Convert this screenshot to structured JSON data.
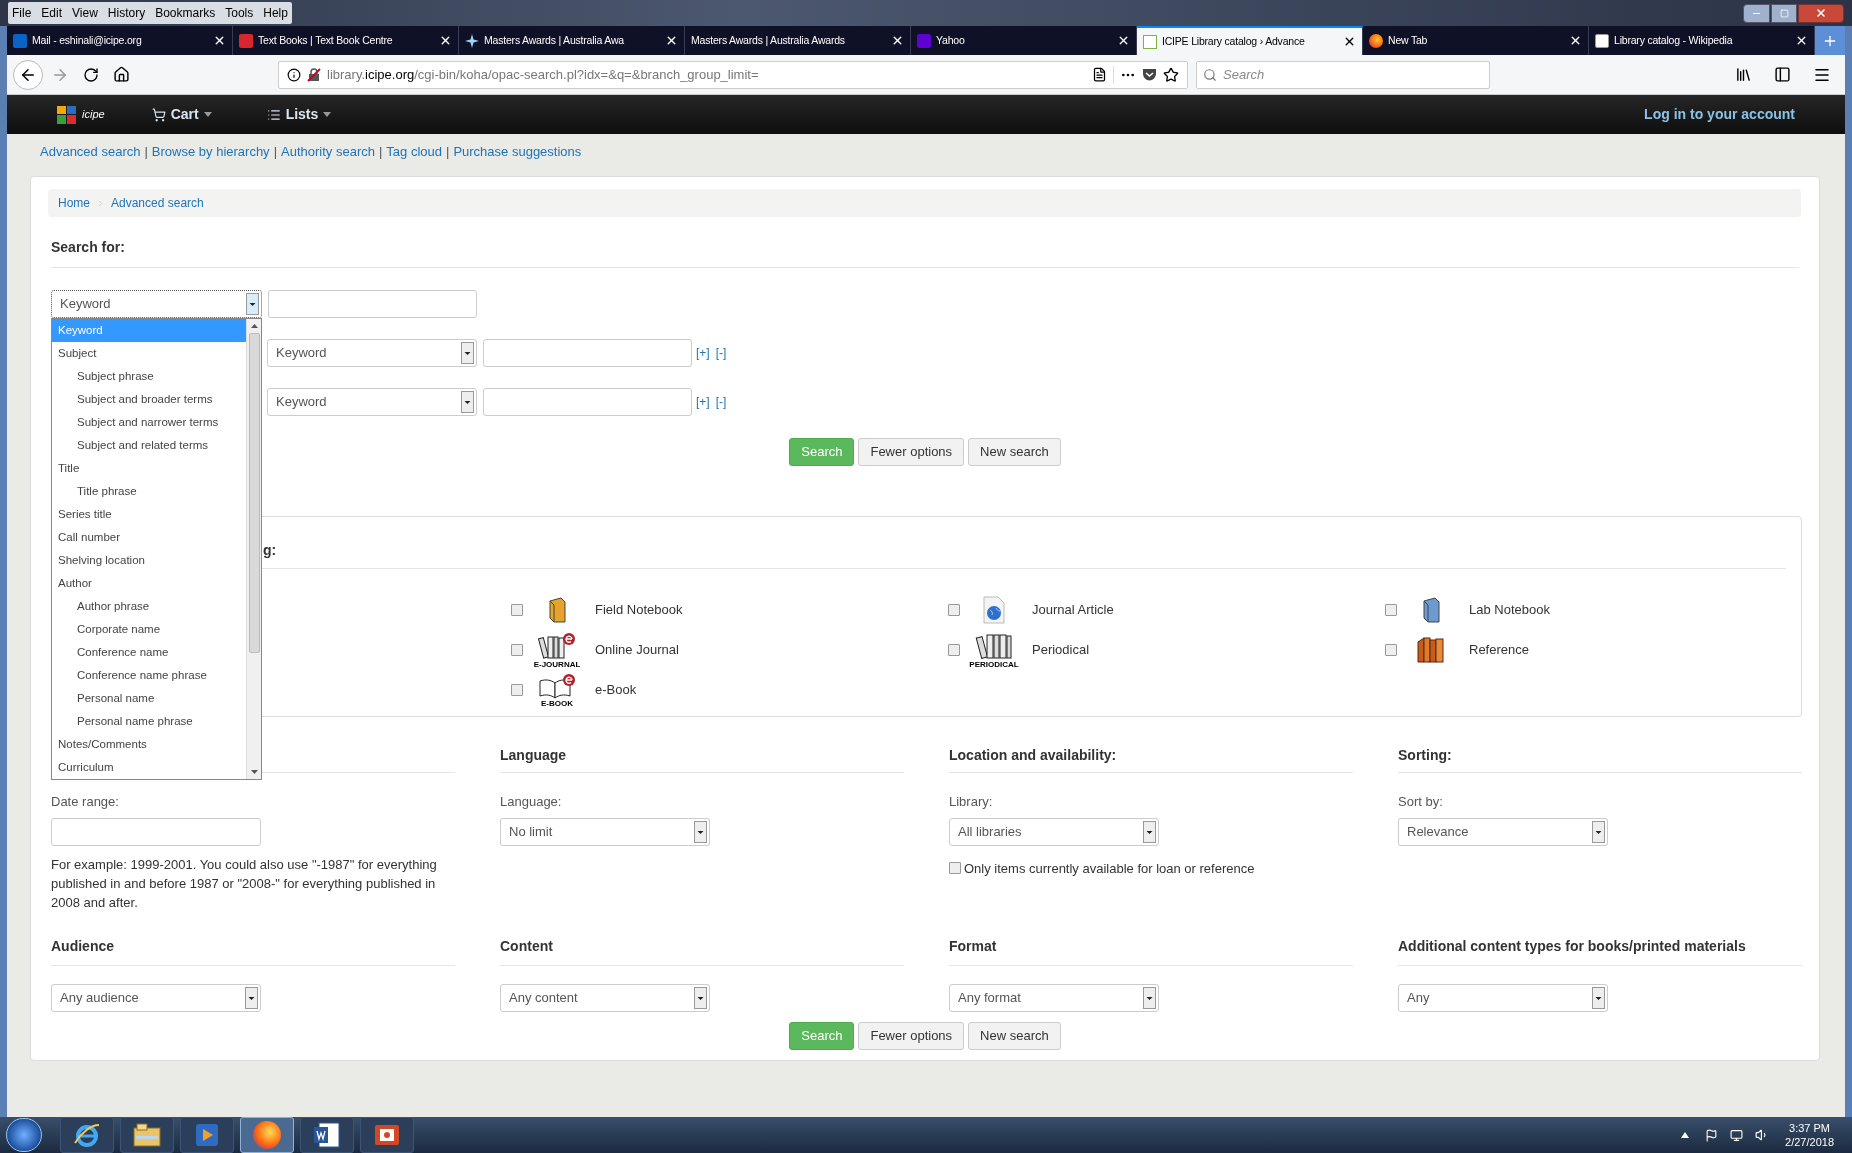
{
  "browser": {
    "menu": [
      "File",
      "Edit",
      "View",
      "History",
      "Bookmarks",
      "Tools",
      "Help"
    ],
    "tabs": [
      {
        "title": "Mail - eshinali@icipe.org",
        "kind": "mail",
        "selected": false
      },
      {
        "title": "Text Books | Text Book Centre",
        "kind": "textbook",
        "selected": false
      },
      {
        "title": "Masters Awards | Australia Awa",
        "kind": "star",
        "selected": false
      },
      {
        "title": "Masters Awards | Australia Awards",
        "kind": "none",
        "selected": false
      },
      {
        "title": "Yahoo",
        "kind": "yahoo",
        "selected": false
      },
      {
        "title": "ICIPE Library catalog › Advance",
        "kind": "koha",
        "selected": true
      },
      {
        "title": "New Tab",
        "kind": "firefox",
        "selected": false
      },
      {
        "title": "Library catalog - Wikipedia",
        "kind": "wikipedia",
        "selected": false
      }
    ],
    "url": "library.**icipe.org**/cgi-bin/koha/opac-search.pl?idx=&q=&branch_group_limit=",
    "search_placeholder": "Search"
  },
  "site": {
    "logo": "icipe",
    "nav": [
      {
        "label": "Cart",
        "kind": "cart"
      },
      {
        "label": "Lists",
        "kind": "list"
      }
    ],
    "login": "Log in to your account",
    "links": [
      "Advanced search",
      "Browse by hierarchy",
      "Authority search",
      "Tag cloud",
      "Purchase suggestions"
    ],
    "link_separator": "|"
  },
  "breadcrumbs": [
    "Home",
    "Advanced search"
  ],
  "search": {
    "heading": "Search for:",
    "rows": [
      {
        "index": "Keyword",
        "open": true
      },
      {
        "index": "Keyword",
        "open": false,
        "add": "[+]",
        "remove": "[-]"
      },
      {
        "index": "Keyword",
        "open": false,
        "add": "[+]",
        "remove": "[-]"
      }
    ],
    "index_options": [
      {
        "label": "Keyword",
        "selected": true
      },
      {
        "label": "Subject",
        "selected": false,
        "children": [
          {
            "label": "Subject phrase",
            "selected": false
          },
          {
            "label": "Subject and broader terms",
            "selected": false
          },
          {
            "label": "Subject and narrower terms",
            "selected": false
          },
          {
            "label": "Subject and related terms",
            "selected": false
          }
        ]
      },
      {
        "label": "Title",
        "selected": false,
        "children": [
          {
            "label": "Title phrase",
            "selected": false
          }
        ]
      },
      {
        "label": "Series title",
        "selected": false
      },
      {
        "label": "Call number",
        "selected": false
      },
      {
        "label": "Shelving location",
        "selected": false
      },
      {
        "label": "Author",
        "selected": false,
        "children": [
          {
            "label": "Author phrase",
            "selected": false
          },
          {
            "label": "Corporate name",
            "selected": false
          },
          {
            "label": "Conference name",
            "selected": false
          },
          {
            "label": "Conference name phrase",
            "selected": false
          },
          {
            "label": "Personal name",
            "selected": false
          },
          {
            "label": "Personal name phrase",
            "selected": false
          }
        ]
      },
      {
        "label": "Notes/Comments",
        "selected": false
      },
      {
        "label": "Curriculum",
        "selected": false
      }
    ]
  },
  "buttons_top": [
    {
      "label": "Search",
      "kind": "primary"
    },
    {
      "label": "Fewer options",
      "kind": "default"
    },
    {
      "label": "New search",
      "kind": "default"
    }
  ],
  "item_types": {
    "heading": "g:",
    "items": [
      {
        "label": "Field Notebook",
        "checked": false,
        "kind": "yellow_book"
      },
      {
        "label": "Journal Article",
        "checked": false,
        "kind": "globe_doc"
      },
      {
        "label": "Lab Notebook",
        "checked": false,
        "kind": "blue_book"
      },
      {
        "label": "Online Journal",
        "checked": false,
        "kind": "e_books",
        "icon_caption": "E-JOURNAL"
      },
      {
        "label": "Periodical",
        "checked": false,
        "kind": "books",
        "icon_caption": "PERIODICAL"
      },
      {
        "label": "Reference",
        "checked": false,
        "kind": "orange_books"
      },
      {
        "label": "e-Book",
        "checked": false,
        "kind": "e_open_book",
        "icon_caption": "E-BOOK"
      }
    ]
  },
  "limits_row1": [
    {
      "kind": "date",
      "label": "Date range:",
      "hint": "For example: 1999-2001. You could also use \"-1987\" for everything published in and before 1987 or \"2008-\" for everything published in 2008 and after."
    },
    {
      "kind": "select",
      "heading": "Language",
      "label": "Language:",
      "value": "No limit"
    },
    {
      "kind": "select",
      "heading": "Location and availability:",
      "label": "Library:",
      "value": "All libraries",
      "checkbox": {
        "label": "Only items currently available for loan or reference",
        "checked": false
      }
    },
    {
      "kind": "select",
      "heading": "Sorting:",
      "label": "Sort by:",
      "value": "Relevance"
    }
  ],
  "limits_row2": [
    {
      "heading": "Audience",
      "value": "Any audience"
    },
    {
      "heading": "Content",
      "value": "Any content"
    },
    {
      "heading": "Format",
      "value": "Any format"
    },
    {
      "heading": "Additional content types for books/printed materials",
      "value": "Any"
    }
  ],
  "buttons_bottom": [
    {
      "label": "Search",
      "kind": "primary"
    },
    {
      "label": "Fewer options",
      "kind": "default"
    },
    {
      "label": "New search",
      "kind": "default"
    }
  ],
  "taskbar": {
    "apps": [
      {
        "kind": "ie",
        "active": false
      },
      {
        "kind": "explorer",
        "active": false
      },
      {
        "kind": "media",
        "active": false
      },
      {
        "kind": "firefox",
        "active": true
      },
      {
        "kind": "word",
        "active": false
      },
      {
        "kind": "powerpoint",
        "active": false
      }
    ],
    "time": "3:37 PM",
    "date": "2/27/2018"
  }
}
